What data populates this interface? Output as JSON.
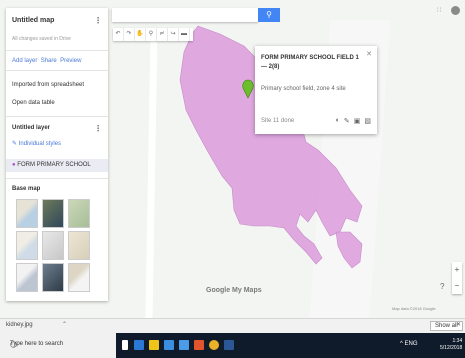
{
  "map": {
    "title": "Untitled map",
    "subtitle": "All changes saved in Drive"
  },
  "panel": {
    "actions": [
      "Add layer",
      "Share",
      "Preview"
    ],
    "imported_label": "Imported from spreadsheet",
    "table_label": "Open data table",
    "layer_title": "Untitled layer",
    "layer_style": "Individual styles",
    "layer_item": "FORM PRIMARY SCHOOL",
    "base_map_label": "Base map"
  },
  "toolbar": {
    "tools": [
      "undo-icon",
      "redo-icon",
      "hand-icon",
      "marker-icon",
      "draw-line-icon",
      "directions-icon",
      "ruler-icon"
    ]
  },
  "infowindow": {
    "title": "FORM PRIMARY SCHOOL FIELD 1 — 2(8)",
    "description": "Primary school field, zone 4 site",
    "footer": "Site 11 done",
    "actions": [
      "paint-icon",
      "edit-icon",
      "photo-icon",
      "delete-icon"
    ]
  },
  "branding": {
    "google": "Google My Maps"
  },
  "attribution": "Map data ©2018 Google",
  "download": {
    "item": "kidney.jpg",
    "show_all": "Show all"
  },
  "taskbar": {
    "search": "Type here to search",
    "clock_time": "1:34",
    "clock_date": "5/12/2018",
    "tray": "^ ENG"
  },
  "colors": {
    "polygon": "#dda0dd",
    "marker": "#6bbf2b",
    "search_button": "#4285f4"
  }
}
